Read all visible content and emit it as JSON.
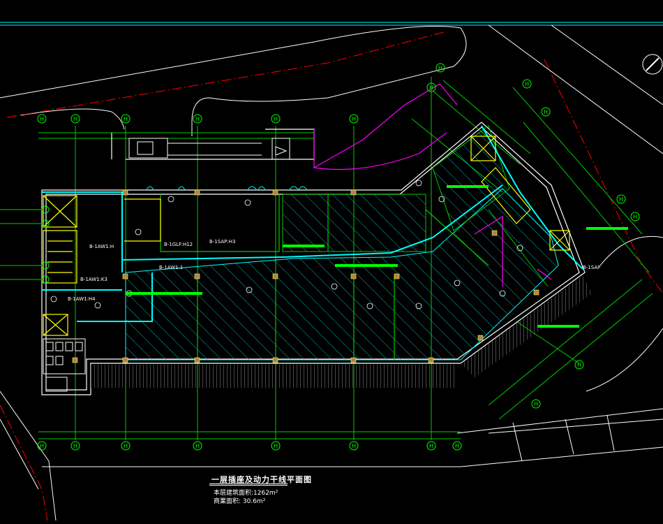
{
  "colors": {
    "background": "#000000",
    "wall": "#ffffff",
    "grid_line": "#00cc00",
    "axis_bubble": "#00ff00",
    "boundary_red": "#ff0000",
    "cyan_cable": "#00ffff",
    "magenta_cable": "#ff00ff",
    "yellow_box": "#ffff00",
    "hatch": "#00ffff"
  },
  "drawing": {
    "title": "一层插座及动力干线平面图",
    "building_area": "本层建筑面积:1262m²",
    "corridor_area": "商業面积: 30.6m²"
  },
  "axis_labels": {
    "top": [
      "H",
      "H",
      "H",
      "H",
      "H",
      "H",
      "H"
    ],
    "bottom": [
      "H",
      "H",
      "H",
      "H",
      "H",
      "H",
      "H",
      "H"
    ],
    "diagonal": [
      "H",
      "H",
      "H",
      "H",
      "H",
      "H",
      "H"
    ]
  },
  "cable_labels": [
    "B-1AW1:H",
    "B-1AW1:K3",
    "B-1AW1:H4",
    "B-1AW1:1",
    "B-1GLF:H12",
    "B-1SAP:H3",
    "B-1SAP"
  ],
  "compass_icon": "north-arrow-icon"
}
